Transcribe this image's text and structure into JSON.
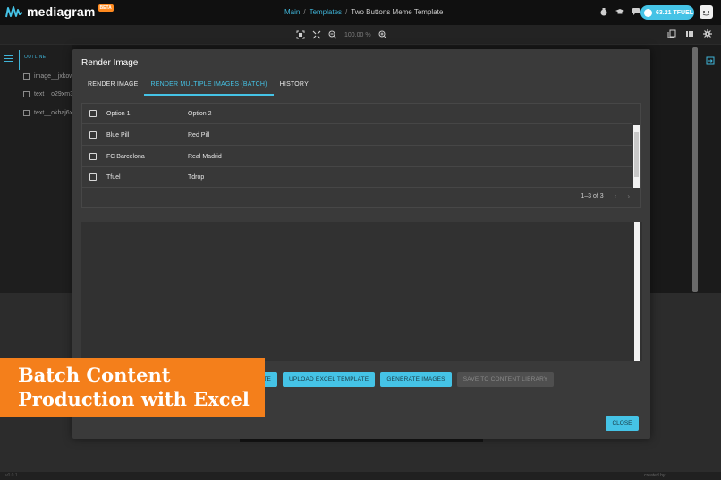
{
  "app": {
    "logo_text": "mediagram",
    "beta_label": "BETA",
    "tfuel_balance": "63.21 TFUEL",
    "accent_color": "#45c3e6",
    "banner_color": "#f47f1b"
  },
  "breadcrumb": {
    "main": "Main",
    "templates": "Templates",
    "current": "Two Buttons Meme Template",
    "separator": "/"
  },
  "toolbar": {
    "zoom_level": "100.00 %"
  },
  "sidebar": {
    "outline_label": "OUTLINE",
    "layers": [
      {
        "label": "image__jxkow"
      },
      {
        "label": "text__o29xm3"
      },
      {
        "label": "text__okhaj6x"
      }
    ]
  },
  "modal": {
    "title": "Render Image",
    "tabs": [
      {
        "label": "RENDER IMAGE"
      },
      {
        "label": "RENDER MULTIPLE IMAGES (BATCH)"
      },
      {
        "label": "HISTORY"
      }
    ],
    "grid": {
      "rows": [
        {
          "option1": "Option 1",
          "option2": "Option 2"
        },
        {
          "option1": "Blue Pill",
          "option2": "Red Pill"
        },
        {
          "option1": "FC Barcelona",
          "option2": "Real Madrid"
        },
        {
          "option1": "Tfuel",
          "option2": "Tdrop"
        }
      ],
      "pagination": "1–3 of 3"
    },
    "buttons": {
      "download_template": "TE",
      "upload_excel": "UPLOAD EXCEL TEMPLATE",
      "generate_images": "GENERATE IMAGES",
      "save_to_library": "SAVE TO CONTENT LIBRARY"
    },
    "close_label": "CLOSE"
  },
  "banner": {
    "line1": "Batch Content",
    "line2": "Production with Excel"
  },
  "footer": {
    "left": "v0.0.1",
    "right": "created by"
  }
}
